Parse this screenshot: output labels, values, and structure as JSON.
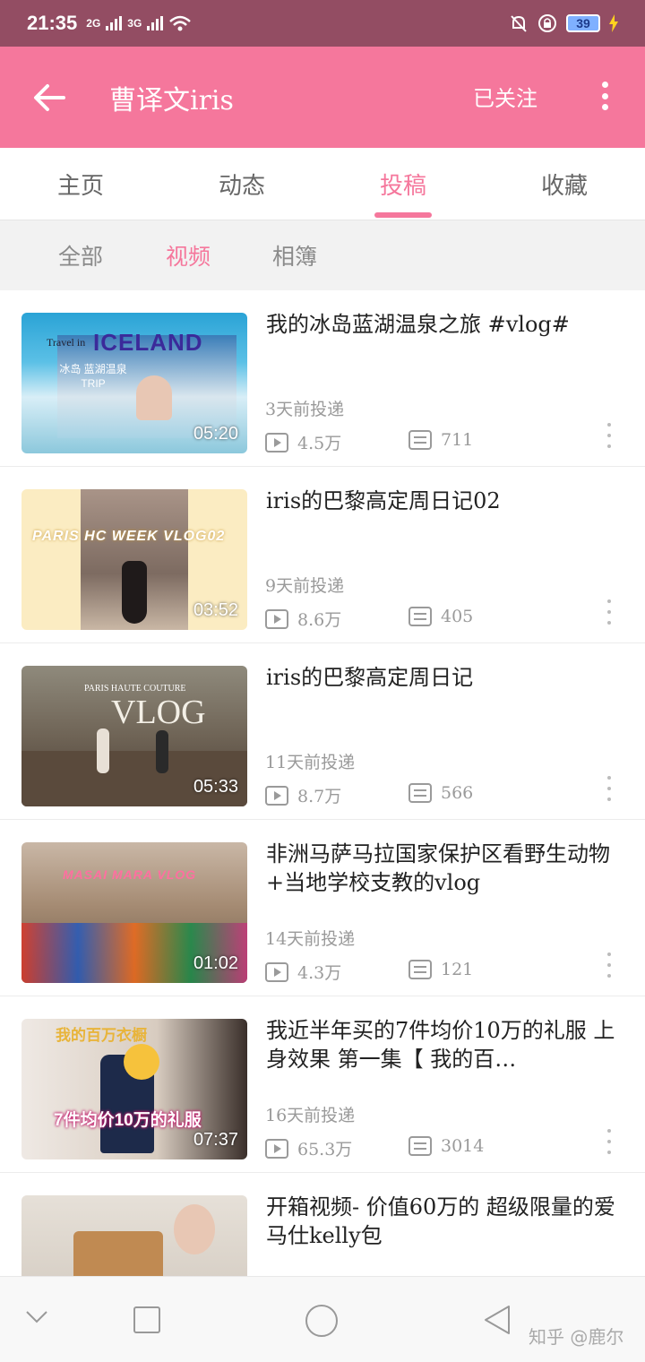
{
  "status_bar": {
    "time": "21:35",
    "net1": "2G",
    "net2": "3G",
    "battery": "39"
  },
  "header": {
    "title": "曹译文iris",
    "follow_label": "已关注"
  },
  "tabs": [
    {
      "label": "主页"
    },
    {
      "label": "动态"
    },
    {
      "label": "投稿"
    },
    {
      "label": "收藏"
    }
  ],
  "active_tab": "投稿",
  "subtabs": [
    {
      "label": "全部"
    },
    {
      "label": "视频"
    },
    {
      "label": "相簿"
    }
  ],
  "videos": [
    {
      "title": "我的冰岛蓝湖温泉之旅 #vlog#",
      "date": "3天前投递",
      "views": "4.5万",
      "comments": "711",
      "duration": "05:20",
      "thumb_text": "ICELAND",
      "thumb_sub": "Travel in",
      "thumb_caption": "冰岛 蓝湖温泉 TRIP"
    },
    {
      "title": "iris的巴黎高定周日记02",
      "date": "9天前投递",
      "views": "8.6万",
      "comments": "405",
      "duration": "03:52",
      "thumb_text": "PARIS HC WEEK VLOG02"
    },
    {
      "title": "iris的巴黎高定周日记",
      "date": "11天前投递",
      "views": "8.7万",
      "comments": "566",
      "duration": "05:33",
      "thumb_text": "VLOG",
      "thumb_sub": "PARIS HAUTE COUTURE"
    },
    {
      "title": "非洲马萨马拉国家保护区看野生动物+当地学校支教的vlog",
      "date": "14天前投递",
      "views": "4.3万",
      "comments": "121",
      "duration": "01:02",
      "thumb_text": "MASAI MARA VLOG"
    },
    {
      "title": "我近半年买的7件均价10万的礼服 上身效果 第一集【 我的百…",
      "date": "16天前投递",
      "views": "65.3万",
      "comments": "3014",
      "duration": "07:37",
      "thumb_text": "7件均价10万的礼服",
      "thumb_sub": "我的百万衣橱"
    },
    {
      "title": "开箱视频- 价值60万的 超级限量的爱马仕kelly包",
      "date": "",
      "views": "",
      "comments": "",
      "duration": ""
    }
  ],
  "watermark": "知乎 @鹿尔",
  "colors": {
    "accent": "#f5779c",
    "status_bar": "#934d63"
  }
}
